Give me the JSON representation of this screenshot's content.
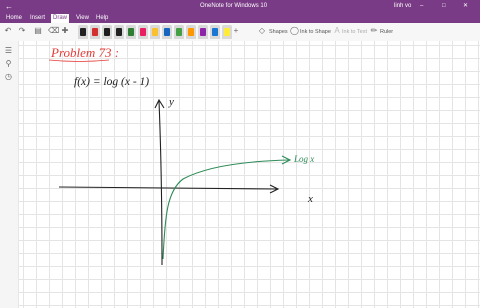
{
  "window": {
    "title": "OneNote for Windows 10",
    "user": "linh vo",
    "back_icon": "back-arrow-icon",
    "forward_icon": "forward-arrow-icon"
  },
  "menu": {
    "items": [
      "Home",
      "Insert",
      "Draw",
      "View",
      "Help"
    ],
    "active": "Draw"
  },
  "toolbar": {
    "shapes_label": "Shapes",
    "ink_to_shape_label": "Ink to Shape",
    "ink_to_text_label": "Ink to Text",
    "ruler_label": "Ruler",
    "pen_colors": [
      "#222222",
      "#d32f2f",
      "#1e1e1e",
      "#222222",
      "#2e7d32",
      "#e91e63",
      "#fbc02d",
      "#1565c0",
      "#43a047",
      "#ff9800",
      "#8e24aa",
      "#1976d2",
      "#ffeb3b"
    ]
  },
  "note": {
    "title": "Problem 73 :",
    "function": "f(x) = log (x - 1)",
    "curve_label": "Log x",
    "x_axis_label": "x",
    "y_axis_label": "y",
    "title_color": "#e53935",
    "ink_color": "#222222",
    "curve_color": "#2e8b57"
  }
}
